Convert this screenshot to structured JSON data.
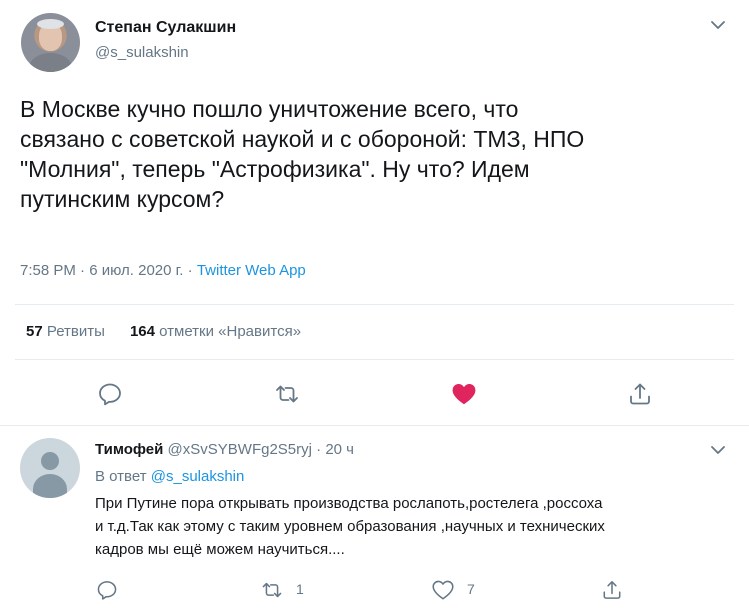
{
  "tweet": {
    "author_name": "Степан Сулакшин",
    "author_handle": "@s_sulakshin",
    "text": "В Москве кучно пошло уничтожение всего, что\nсвязано с советской наукой и с обороной: ТМЗ, НПО\n\"Молния\", теперь \"Астрофизика\". Ну что? Идем\nпутинским курсом?",
    "time": "7:58 PM",
    "date": "6 июл. 2020 г.",
    "separator": " · ",
    "source": "Twitter Web App",
    "retweets_count": "57",
    "retweets_label": "Ретвиты",
    "likes_count": "164",
    "likes_label": "отметки «Нравится»",
    "liked": true
  },
  "reply": {
    "author_name": "Тимофей",
    "author_handle": "@xSvSYBWFg2S5ryj",
    "separator": " · ",
    "age": "20 ч",
    "in_reply_prefix": "В ответ ",
    "in_reply_handle": "@s_sulakshin",
    "text": "При Путине пора  открывать производства рослапоть,ростелега ,россоха\nи т.д.Так как этому с таким уровнем образования ,научных и технических\nкадров  мы ещё можем научиться....",
    "retweets_count": "1",
    "likes_count": "7"
  },
  "icons": {
    "more": "chevron-down-icon",
    "reply": "reply-icon",
    "retweet": "retweet-icon",
    "like": "heart-icon",
    "share": "share-icon"
  },
  "colors": {
    "link": "#1b95e0",
    "muted": "#657786",
    "like_active": "#e0245e",
    "divider": "#e6ecf0"
  }
}
